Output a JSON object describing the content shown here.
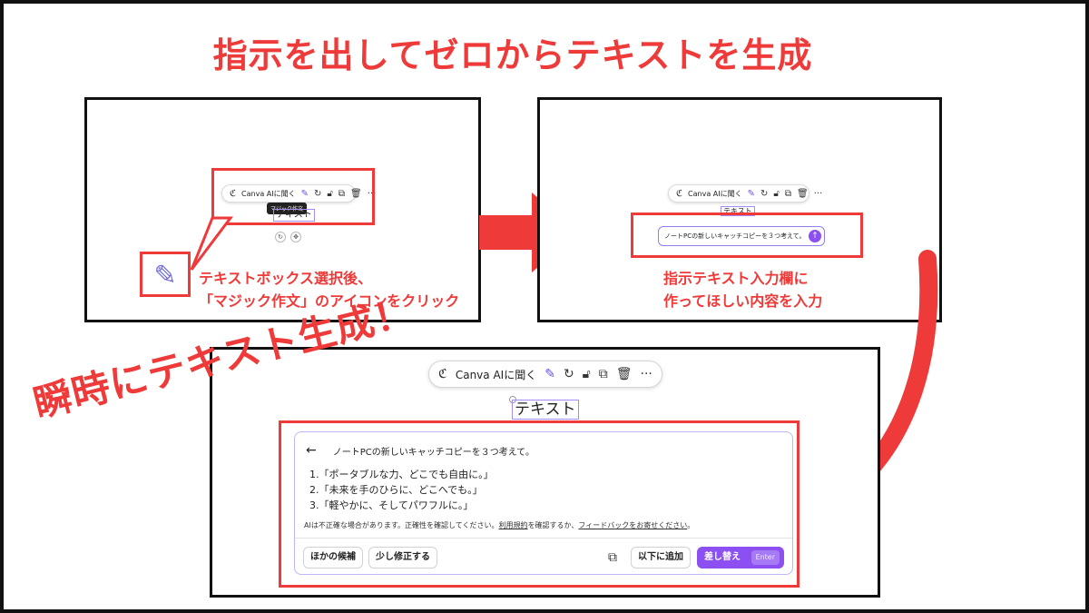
{
  "title": "指示を出してゼロからテキストを生成",
  "panel1": {
    "toolbar_label": "Canva AIに聞く",
    "tooltip": "マジック作文",
    "canvas_text": "テキスト",
    "caption_line1": "テキストボックス選択後、",
    "caption_line2": "「マジック作文」のアイコンをクリック"
  },
  "panel2": {
    "toolbar_label": "Canva AIに聞く",
    "canvas_text": "テキスト",
    "prompt_value": "ノートPCの新しいキャッチコピーを３つ考えて。",
    "caption_line1": "指示テキスト入力欄に",
    "caption_line2": "作ってほしい内容を入力"
  },
  "panel3": {
    "toolbar_label": "Canva AIに聞く",
    "canvas_text": "テキスト",
    "prompt_echo": "ノートPCの新しいキャッチコピーを３つ考えて。",
    "suggestions": [
      "1.「ポータブルな力、どこでも自由に。」",
      "2.「未来を手のひらに、どこへでも。」",
      "3.「軽やかに、そしてパワフルに。」"
    ],
    "disclaimer_prefix": "AIは不正確な場合があります。正確性を確認してください。",
    "terms_link": "利用規約",
    "disclaimer_mid": "を確認するか、",
    "feedback_link": "フィードバックをお寄せください",
    "disclaimer_end": "。",
    "other_button": "ほかの候補",
    "modify_button": "少し修正する",
    "append_button": "以下に追加",
    "replace_button": "差し替え",
    "replace_shortcut": "Enter"
  },
  "overlay_text": "瞬時にテキスト生成！",
  "colors": {
    "accent_red": "#ef3a3a",
    "accent_purple": "#8b4ff2"
  },
  "icons": [
    "canva-ai-icon",
    "magic-write-icon",
    "regenerate-icon",
    "lock-icon",
    "duplicate-icon",
    "trash-icon",
    "more-icon",
    "back-arrow-icon",
    "copy-icon",
    "send-icon"
  ]
}
